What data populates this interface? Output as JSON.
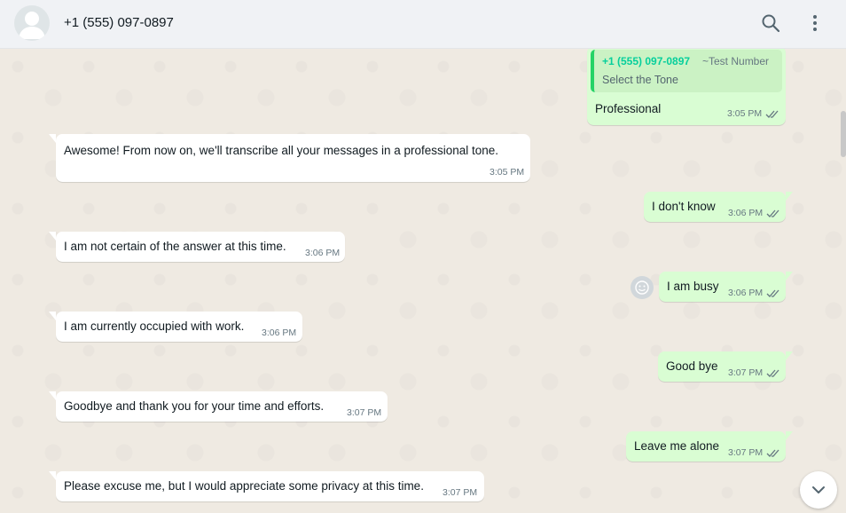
{
  "header": {
    "contact_name": "+1 (555) 097-0897",
    "icons": [
      "default-avatar-icon",
      "search-icon",
      "menu-icon"
    ]
  },
  "messages": [
    {
      "direction": "outgoing",
      "quoted": {
        "author": "+1 (555) 097-0897",
        "tag": "~Test Number",
        "text": "Select the Tone"
      },
      "text": "Professional",
      "time": "3:05 PM",
      "status": "read"
    },
    {
      "direction": "incoming",
      "text": "Awesome! From now on, we'll transcribe all your messages in a professional tone.",
      "time": "3:05 PM"
    },
    {
      "direction": "outgoing",
      "text": "I don't know",
      "time": "3:06 PM",
      "status": "read"
    },
    {
      "direction": "incoming",
      "text": "I am not certain of the answer at this time.",
      "time": "3:06 PM"
    },
    {
      "direction": "outgoing",
      "text": "I am busy",
      "time": "3:06 PM",
      "status": "read"
    },
    {
      "direction": "incoming",
      "text": "I am currently occupied with work.",
      "time": "3:06 PM"
    },
    {
      "direction": "outgoing",
      "text": "Good bye",
      "time": "3:07 PM",
      "status": "read"
    },
    {
      "direction": "incoming",
      "text": "Goodbye and thank you for your time and efforts.",
      "time": "3:07 PM"
    },
    {
      "direction": "outgoing",
      "text": "Leave me alone",
      "time": "3:07 PM",
      "status": "read"
    },
    {
      "direction": "incoming",
      "text": "Please excuse me, but I would appreciate some privacy at this time.",
      "time": "3:07 PM"
    }
  ],
  "colors": {
    "outgoing_bubble": "#d9fdd3",
    "incoming_bubble": "#ffffff",
    "read_ticks": "#667781",
    "quote_accent": "#25d366",
    "chat_background": "#efeae2"
  }
}
